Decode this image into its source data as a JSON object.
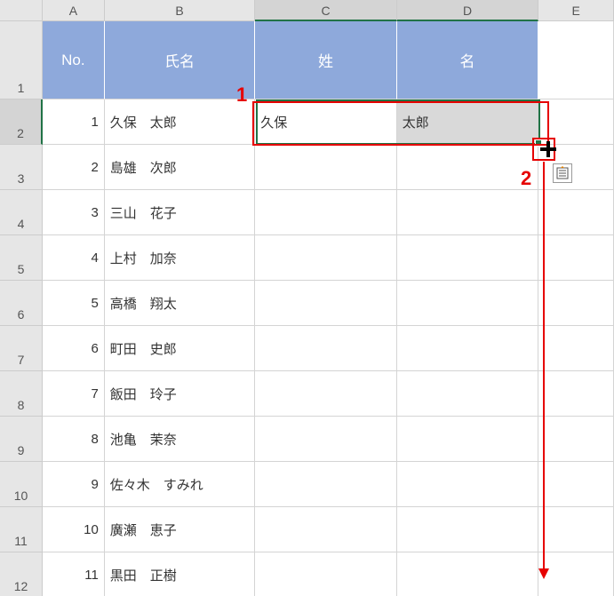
{
  "columns": [
    "A",
    "B",
    "C",
    "D",
    "E"
  ],
  "rowNumbers": [
    1,
    2,
    3,
    4,
    5,
    6,
    7,
    8,
    9,
    10,
    11,
    12
  ],
  "headerRow": {
    "no": "No.",
    "name": "氏名",
    "sei": "姓",
    "mei": "名"
  },
  "rows": [
    {
      "no": "1",
      "name": "久保　太郎",
      "sei": "久保",
      "mei": "太郎"
    },
    {
      "no": "2",
      "name": "島雄　次郎",
      "sei": "",
      "mei": ""
    },
    {
      "no": "3",
      "name": "三山　花子",
      "sei": "",
      "mei": ""
    },
    {
      "no": "4",
      "name": "上村　加奈",
      "sei": "",
      "mei": ""
    },
    {
      "no": "5",
      "name": "高橋　翔太",
      "sei": "",
      "mei": ""
    },
    {
      "no": "6",
      "name": "町田　史郎",
      "sei": "",
      "mei": ""
    },
    {
      "no": "7",
      "name": "飯田　玲子",
      "sei": "",
      "mei": ""
    },
    {
      "no": "8",
      "name": "池亀　茉奈",
      "sei": "",
      "mei": ""
    },
    {
      "no": "9",
      "name": "佐々木　すみれ",
      "sei": "",
      "mei": ""
    },
    {
      "no": "10",
      "name": "廣瀬　恵子",
      "sei": "",
      "mei": ""
    },
    {
      "no": "11",
      "name": "黒田　正樹",
      "sei": "",
      "mei": ""
    }
  ],
  "annotations": {
    "label1": "1",
    "label2": "2"
  }
}
